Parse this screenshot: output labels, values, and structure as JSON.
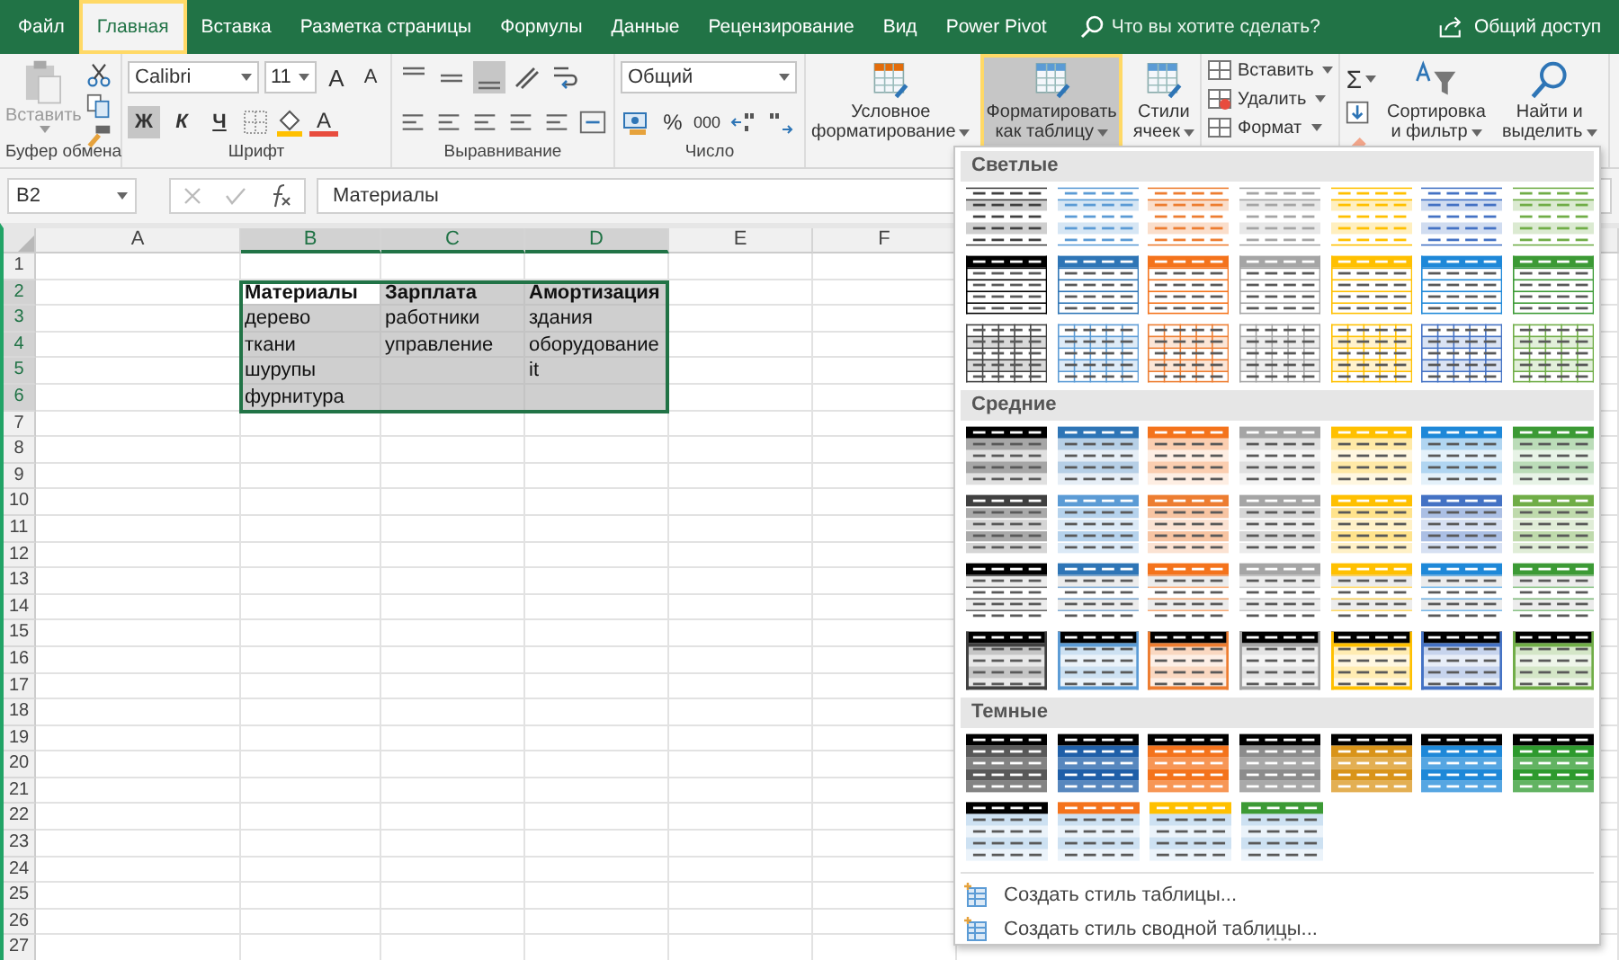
{
  "tabs": [
    {
      "label": "Файл",
      "selected": false
    },
    {
      "label": "Главная",
      "selected": true
    },
    {
      "label": "Вставка",
      "selected": false
    },
    {
      "label": "Разметка страницы",
      "selected": false
    },
    {
      "label": "Формулы",
      "selected": false
    },
    {
      "label": "Данные",
      "selected": false
    },
    {
      "label": "Рецензирование",
      "selected": false
    },
    {
      "label": "Вид",
      "selected": false
    },
    {
      "label": "Power Pivot",
      "selected": false
    }
  ],
  "tell_me": {
    "placeholder": "Что вы хотите сделать?"
  },
  "share": "Общий доступ",
  "ribbon": {
    "clipboard": {
      "paste": "Вставить",
      "label": "Буфер обмена"
    },
    "font": {
      "name": "Calibri",
      "size": "11",
      "grow": "A",
      "shrink": "A",
      "styles": [
        {
          "label": "Ж",
          "selected": true
        },
        {
          "label": "К",
          "selected": false
        },
        {
          "label": "Ч",
          "selected": false
        }
      ],
      "font_color": "A",
      "label": "Шрифт"
    },
    "alignment": {
      "vertical": [
        {
          "selected": false
        },
        {
          "selected": false
        },
        {
          "selected": true
        }
      ],
      "label": "Выравнивание"
    },
    "number": {
      "format": "Общий",
      "percent": "%",
      "thousands": "000",
      "label": "Число"
    },
    "styles": [
      {
        "lines": [
          "Условное",
          "форматирование"
        ],
        "selected": false
      },
      {
        "lines": [
          "Форматировать",
          "как таблицу"
        ],
        "selected": true
      },
      {
        "lines": [
          "Стили",
          "ячеек"
        ],
        "selected": false
      }
    ],
    "cells": [
      "Вставить",
      "Удалить",
      "Формат"
    ],
    "editing": {
      "sum": "Σ",
      "sort": [
        "Сортировка",
        "и фильтр"
      ],
      "find": [
        "Найти и",
        "выделить"
      ]
    }
  },
  "formula_bar": {
    "name_box": "B2",
    "value": "Материалы"
  },
  "sheet": {
    "columns": [
      {
        "label": "A",
        "selected": false
      },
      {
        "label": "B",
        "selected": true
      },
      {
        "label": "C",
        "selected": true
      },
      {
        "label": "D",
        "selected": true
      },
      {
        "label": "E",
        "selected": false
      },
      {
        "label": "F",
        "selected": false
      }
    ],
    "rows": [
      {
        "number": "1",
        "selected": false
      },
      {
        "number": "2",
        "selected": true,
        "cells": [
          {
            "selected": false
          },
          {
            "text": "Материалы",
            "bold": true,
            "selected": true,
            "active": true
          },
          {
            "text": "Зарплата",
            "bold": true,
            "selected": true,
            "active": false
          },
          {
            "text": "Амортизация",
            "bold": true,
            "selected": true,
            "active": false
          },
          {
            "selected": false
          },
          {
            "selected": false
          }
        ]
      },
      {
        "number": "3",
        "selected": true,
        "cells": [
          {
            "selected": false
          },
          {
            "text": "дерево",
            "bold": false,
            "selected": true,
            "active": false
          },
          {
            "text": "работники",
            "bold": false,
            "selected": true,
            "active": false
          },
          {
            "text": "здания",
            "bold": false,
            "selected": true,
            "active": false
          },
          {
            "selected": false
          },
          {
            "selected": false
          }
        ]
      },
      {
        "number": "4",
        "selected": true,
        "cells": [
          {
            "selected": false
          },
          {
            "text": "ткани",
            "bold": false,
            "selected": true,
            "active": false
          },
          {
            "text": "управление",
            "bold": false,
            "selected": true,
            "active": false
          },
          {
            "text": "оборудование",
            "bold": false,
            "selected": true,
            "active": false
          },
          {
            "selected": false
          },
          {
            "selected": false
          }
        ]
      },
      {
        "number": "5",
        "selected": true,
        "cells": [
          {
            "selected": false
          },
          {
            "text": "шурупы",
            "bold": false,
            "selected": true,
            "active": false
          },
          {
            "selected": true,
            "active": false
          },
          {
            "text": "it",
            "bold": false,
            "selected": true,
            "active": false
          },
          {
            "selected": false
          },
          {
            "selected": false
          }
        ]
      },
      {
        "number": "6",
        "selected": true,
        "cells": [
          {
            "selected": false
          },
          {
            "text": "фурнитура",
            "bold": false,
            "selected": true,
            "active": false
          },
          {
            "selected": true,
            "active": false
          },
          {
            "selected": true,
            "active": false
          },
          {
            "selected": false
          },
          {
            "selected": false
          }
        ]
      },
      {
        "number": "7",
        "selected": false
      },
      {
        "number": "8",
        "selected": false
      },
      {
        "number": "9",
        "selected": false
      },
      {
        "number": "10",
        "selected": false
      },
      {
        "number": "11",
        "selected": false
      },
      {
        "number": "12",
        "selected": false
      },
      {
        "number": "13",
        "selected": false
      },
      {
        "number": "14",
        "selected": false
      },
      {
        "number": "15",
        "selected": false
      },
      {
        "number": "16",
        "selected": false
      },
      {
        "number": "17",
        "selected": false
      },
      {
        "number": "18",
        "selected": false
      },
      {
        "number": "19",
        "selected": false
      },
      {
        "number": "20",
        "selected": false
      },
      {
        "number": "21",
        "selected": false
      },
      {
        "number": "22",
        "selected": false
      },
      {
        "number": "23",
        "selected": false
      },
      {
        "number": "24",
        "selected": false
      },
      {
        "number": "25",
        "selected": false
      },
      {
        "number": "26",
        "selected": false
      },
      {
        "number": "27",
        "selected": false
      }
    ]
  },
  "gallery": {
    "sections": [
      {
        "title": "Светлые",
        "rows": [
          [
            {
              "kind": "light-lines",
              "color": "#404040"
            },
            {
              "kind": "light-lines",
              "color": "#5b9bd5"
            },
            {
              "kind": "light-lines",
              "color": "#ed7d31"
            },
            {
              "kind": "light-lines",
              "color": "#a5a5a5"
            },
            {
              "kind": "light-lines",
              "color": "#ffc000"
            },
            {
              "kind": "light-lines",
              "color": "#4472c4"
            },
            {
              "kind": "light-lines",
              "color": "#70ad47"
            }
          ],
          [
            {
              "kind": "light-header",
              "color": "#000000"
            },
            {
              "kind": "light-header",
              "color": "#2e75b6"
            },
            {
              "kind": "light-header",
              "color": "#f4731c"
            },
            {
              "kind": "light-header",
              "color": "#a5a5a5"
            },
            {
              "kind": "light-header",
              "color": "#ffc000"
            },
            {
              "kind": "light-header",
              "color": "#1e88d8"
            },
            {
              "kind": "light-header",
              "color": "#3c9a35"
            }
          ],
          [
            {
              "kind": "light-grid",
              "color": "#404040"
            },
            {
              "kind": "light-grid",
              "color": "#5b9bd5"
            },
            {
              "kind": "light-grid",
              "color": "#ed7d31"
            },
            {
              "kind": "light-grid",
              "color": "#a5a5a5"
            },
            {
              "kind": "light-grid",
              "color": "#ffc000"
            },
            {
              "kind": "light-grid",
              "color": "#4472c4"
            },
            {
              "kind": "light-grid",
              "color": "#70ad47"
            }
          ]
        ]
      },
      {
        "title": "Средние",
        "rows": [
          [
            {
              "kind": "medium-header",
              "color": "#000000"
            },
            {
              "kind": "medium-header",
              "color": "#2e75b6"
            },
            {
              "kind": "medium-header",
              "color": "#f4731c"
            },
            {
              "kind": "medium-header",
              "color": "#a5a5a5"
            },
            {
              "kind": "medium-header",
              "color": "#ffc000"
            },
            {
              "kind": "medium-header",
              "color": "#1e88d8"
            },
            {
              "kind": "medium-header",
              "color": "#3c9a35"
            }
          ],
          [
            {
              "kind": "medium-banded",
              "color": "#404040"
            },
            {
              "kind": "medium-banded",
              "color": "#5b9bd5"
            },
            {
              "kind": "medium-banded",
              "color": "#ed7d31"
            },
            {
              "kind": "medium-banded",
              "color": "#a5a5a5"
            },
            {
              "kind": "medium-banded",
              "color": "#ffc000"
            },
            {
              "kind": "medium-banded",
              "color": "#4472c4"
            },
            {
              "kind": "medium-banded",
              "color": "#70ad47"
            }
          ],
          [
            {
              "kind": "medium-lines",
              "color": "#000000"
            },
            {
              "kind": "medium-lines",
              "color": "#2e75b6"
            },
            {
              "kind": "medium-lines",
              "color": "#f4731c"
            },
            {
              "kind": "medium-lines",
              "color": "#a5a5a5"
            },
            {
              "kind": "medium-lines",
              "color": "#ffc000"
            },
            {
              "kind": "medium-lines",
              "color": "#1e88d8"
            },
            {
              "kind": "medium-lines",
              "color": "#3c9a35"
            }
          ],
          [
            {
              "kind": "medium-gray",
              "color": "#404040"
            },
            {
              "kind": "medium-gray",
              "color": "#5b9bd5"
            },
            {
              "kind": "medium-gray",
              "color": "#ed7d31"
            },
            {
              "kind": "medium-gray",
              "color": "#a5a5a5"
            },
            {
              "kind": "medium-gray",
              "color": "#ffc000"
            },
            {
              "kind": "medium-gray",
              "color": "#4472c4"
            },
            {
              "kind": "medium-gray",
              "color": "#70ad47"
            }
          ]
        ]
      },
      {
        "title": "Темные",
        "rows": [
          [
            {
              "kind": "dark",
              "color": "#595959"
            },
            {
              "kind": "dark",
              "color": "#1f5fa8"
            },
            {
              "kind": "dark",
              "color": "#f4731c"
            },
            {
              "kind": "dark",
              "color": "#8c8c8c"
            },
            {
              "kind": "dark",
              "color": "#d9941a"
            },
            {
              "kind": "dark",
              "color": "#1e88d8"
            },
            {
              "kind": "dark",
              "color": "#2e9a2e"
            }
          ],
          [
            {
              "kind": "dark-light",
              "color": "#000000"
            },
            {
              "kind": "dark-light",
              "color": "#f4731c"
            },
            {
              "kind": "dark-light",
              "color": "#ffc000"
            },
            {
              "kind": "dark-light",
              "color": "#3c9a35"
            }
          ]
        ]
      }
    ],
    "commands": [
      "Создать стиль таблицы...",
      "Создать стиль сводной таблицы..."
    ]
  }
}
